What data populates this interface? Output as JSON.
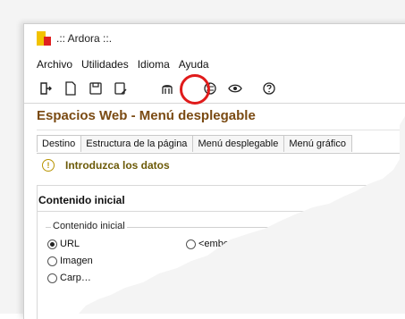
{
  "window": {
    "title": ".:: Ardora ::."
  },
  "menu": [
    "Archivo",
    "Utilidades",
    "Idioma",
    "Ayuda"
  ],
  "toolbar_icons": [
    "exit-icon",
    "new-file-icon",
    "save-icon",
    "save-as-icon",
    "web-spaces-icon",
    "globe-icon",
    "eye-icon",
    "help-icon"
  ],
  "heading": "Espacios Web - Menú desplegable",
  "tabs": [
    "Destino",
    "Estructura de la página",
    "Menú desplegable",
    "Menú gráfico"
  ],
  "hint": "Introduzca los datos",
  "panel": {
    "title": "Contenido inicial",
    "checked": true,
    "group_label": "Contenido inicial"
  },
  "options": {
    "url": "URL",
    "imagen": "Imagen",
    "carpeta": "Carp…",
    "embed": "<embed>"
  },
  "accent": {
    "highlight": "#e01b1b",
    "heading": "#7a4a12",
    "hint": "#6c5a08"
  }
}
